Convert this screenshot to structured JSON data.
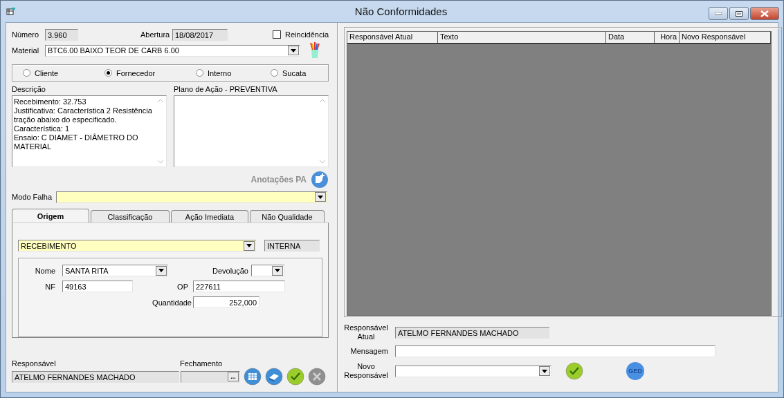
{
  "window": {
    "title": "Não Conformidades"
  },
  "header": {
    "numero_label": "Número",
    "numero": "3.960",
    "abertura_label": "Abertura",
    "abertura": "18/08/2017",
    "reincidencia": {
      "label": "Reincidência",
      "checked": false
    },
    "material_label": "Material",
    "material": "BTC6.00  BAIXO TEOR DE CARB 6.00"
  },
  "origin_types": [
    {
      "label": "Cliente",
      "selected": false
    },
    {
      "label": "Fornecedor",
      "selected": true
    },
    {
      "label": "Interno",
      "selected": false
    },
    {
      "label": "Sucata",
      "selected": false
    }
  ],
  "descricao": {
    "label": "Descrição",
    "lines": [
      "Recebimento: 32.753",
      "Justificativa: Característica 2 Resistência",
      "tração abaixo do especificado.",
      "Característica: 1",
      "Ensaio: C DIAMET - DIÂMETRO DO",
      "MATERIAL"
    ]
  },
  "plano": {
    "label": "Plano de Ação - PREVENTIVA"
  },
  "anotacoes": {
    "label": "Anotações PA"
  },
  "modo_falha": {
    "label": "Modo Falha"
  },
  "tabs": [
    {
      "label": "Origem",
      "selected": true
    },
    {
      "label": "Classificação",
      "selected": false
    },
    {
      "label": "Ação Imediata",
      "selected": false
    },
    {
      "label": "Não Qualidade",
      "selected": false
    }
  ],
  "origem": {
    "tipo": "RECEBIMENTO",
    "classe": "INTERNA",
    "nome_label": "Nome",
    "nome": "SANTA RITA",
    "devolucao_label": "Devolução",
    "nf_label": "NF",
    "nf": "49163",
    "op_label": "OP",
    "op": "227611",
    "quantidade_label": "Quantidade",
    "quantidade": "252,000"
  },
  "footer": {
    "responsavel_label": "Responsável",
    "responsavel": "ATELMO FERNANDES MACHADO",
    "fechamento_label": "Fechamento",
    "fechamento_button": "...",
    "actions": [
      {
        "kind": "grid",
        "disabled": false
      },
      {
        "kind": "eraser",
        "disabled": false
      },
      {
        "kind": "confirm",
        "disabled": false
      },
      {
        "kind": "cancel",
        "disabled": true
      }
    ]
  },
  "history": {
    "columns": [
      "Responsável Atual",
      "Texto",
      "Data",
      "Hora",
      "Novo Responsável"
    ]
  },
  "tramite": {
    "responsavel_atual_label": "Responsável Atual",
    "responsavel_atual": "ATELMO FERNANDES MACHADO",
    "mensagem_label": "Mensagem",
    "novo_responsavel_label": "Novo Responsável",
    "ged_button": "GED"
  }
}
